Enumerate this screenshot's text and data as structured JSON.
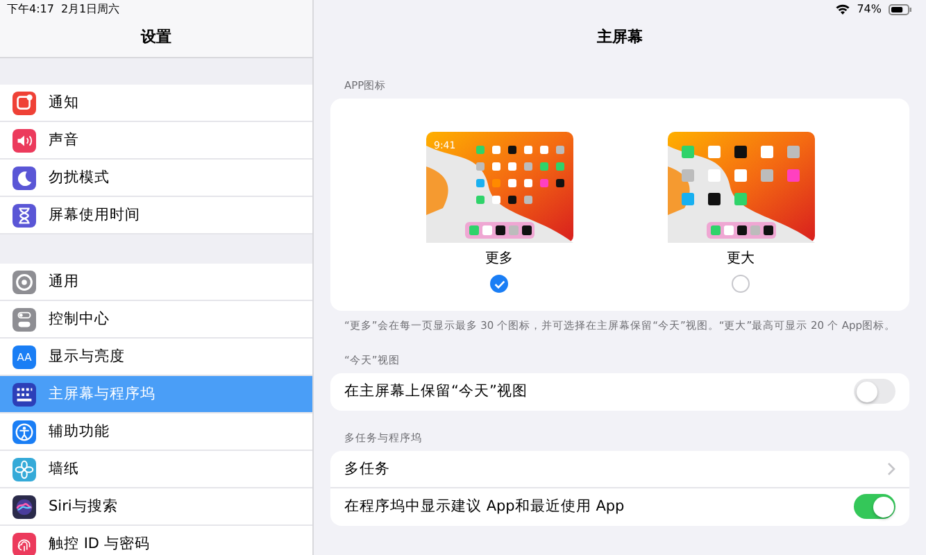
{
  "status_bar": {
    "time": "下午4:17",
    "date": "2月1日周六",
    "battery": "74%"
  },
  "sidebar": {
    "title": "设置",
    "groups": [
      [
        {
          "label": "通知",
          "color": "#ef4136",
          "selected": false
        },
        {
          "label": "声音",
          "color": "#ec3a5c",
          "selected": false
        },
        {
          "label": "勿扰模式",
          "color": "#5a56d6",
          "selected": false
        },
        {
          "label": "屏幕使用时间",
          "color": "#5a56d6",
          "selected": false
        }
      ],
      [
        {
          "label": "通用",
          "color": "#8e8e93",
          "selected": false
        },
        {
          "label": "控制中心",
          "color": "#8e8e93",
          "selected": false
        },
        {
          "label": "显示与亮度",
          "icon_text": "AA",
          "color": "#1a7ef5",
          "selected": false
        },
        {
          "label": "主屏幕与程序坞",
          "color": "#2c3fb8",
          "selected": true
        },
        {
          "label": "辅助功能",
          "color": "#1a7ef5",
          "selected": false
        },
        {
          "label": "墙纸",
          "color": "#35aad8",
          "selected": false
        },
        {
          "label": "Siri与搜索",
          "color": "#2a2a4a",
          "selected": false
        },
        {
          "label": "触控 ID 与密码",
          "color": "#ec3a5c",
          "selected": false
        }
      ]
    ]
  },
  "main": {
    "title": "主屏幕",
    "app_icons": {
      "header": "APP图标",
      "options": [
        {
          "label": "更多",
          "clock": "9:41",
          "selected": true
        },
        {
          "label": "更大",
          "selected": false
        }
      ],
      "footer": "“更多”会在每一页显示最多 30 个图标，并可选择在主屏幕保留“今天”视图。“更大”最高可显示 20 个 App图标。"
    },
    "sections": [
      {
        "header": "“今天”视图",
        "rows": [
          {
            "label": "在主屏幕上保留“今天”视图",
            "kind": "toggle",
            "on": false
          }
        ]
      },
      {
        "header": "多任务与程序坞",
        "rows": [
          {
            "label": "多任务",
            "kind": "link"
          },
          {
            "label": "在程序坞中显示建议 App和最近使用 App",
            "kind": "toggle",
            "on": true
          }
        ]
      }
    ]
  }
}
